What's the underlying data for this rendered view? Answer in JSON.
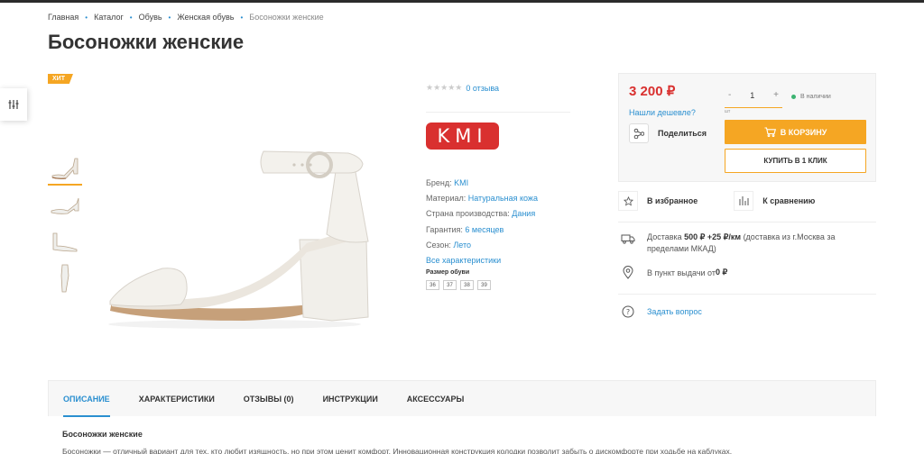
{
  "breadcrumbs": [
    "Главная",
    "Каталог",
    "Обувь",
    "Женская обувь",
    "Босоножки женские"
  ],
  "page_title": "Босоножки женские",
  "badge": "ХИТ",
  "rating": {
    "stars": "★★★★★",
    "reviews_link": "0 отзыва"
  },
  "brand_logo_text": "KMI",
  "properties": [
    {
      "label": "Бренд:",
      "value": "KMI"
    },
    {
      "label": "Материал:",
      "value": "Натуральная кожа"
    },
    {
      "label": "Страна производства:",
      "value": "Дания"
    },
    {
      "label": "Гарантия:",
      "value": "6 месяцев"
    },
    {
      "label": "Сезон:",
      "value": "Лето"
    }
  ],
  "all_props_link": "Все характеристики",
  "size_label": "Размер обуви",
  "sizes": [
    "36",
    "37",
    "38",
    "39"
  ],
  "buy": {
    "price": "3 200 ₽",
    "cheaper_link": "Нашли дешевле?",
    "share_label": "Поделиться",
    "qty_minus": "-",
    "qty_value": "1",
    "qty_plus": "+",
    "unit": "шт",
    "stock": "В наличии",
    "cart_button": "В КОРЗИНУ",
    "one_click_button": "КУПИТЬ В 1 КЛИК"
  },
  "favorites_label": "В избранное",
  "compare_label": "К сравнению",
  "delivery": {
    "prefix": "Доставка ",
    "price": "500 ₽ +25 ₽/км",
    "suffix": " (доставка из г.Москва за пределами МКАД)"
  },
  "pickup": {
    "prefix": "В пункт выдачи от ",
    "price": "0 ₽"
  },
  "ask_link": "Задать вопрос",
  "tabs": [
    "ОПИСАНИЕ",
    "ХАРАКТЕРИСТИКИ",
    "ОТЗЫВЫ (0)",
    "ИНСТРУКЦИИ",
    "АКСЕССУАРЫ"
  ],
  "description": {
    "title": "Босоножки женские",
    "text": "Босоножки — отличный вариант для тех, кто любит изящность, но при этом ценит комфорт. Инновационная конструкция колодки позволит забыть о дискомфорте при ходьбе на каблуках."
  },
  "colors": {
    "accent": "#f5a623",
    "link": "#2a8fd0",
    "price": "#d9302f",
    "brand": "#d9302f",
    "stock": "#3cb371"
  }
}
